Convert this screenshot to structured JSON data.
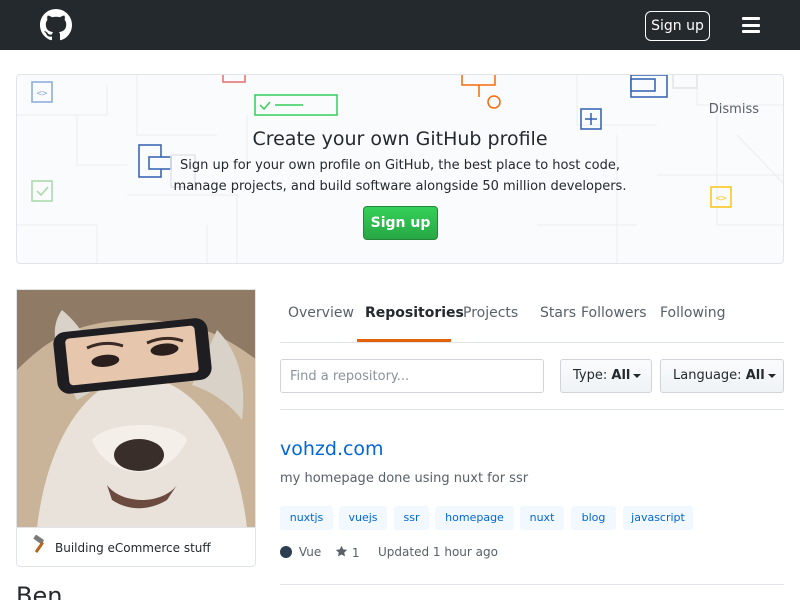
{
  "header": {
    "logo_icon": "github-octocat-icon",
    "signup_label": "Sign up",
    "menu_icon": "hamburger-menu-icon",
    "background": "#24292e"
  },
  "banner": {
    "title": "Create your own GitHub profile",
    "text": "Sign up for your own profile on GitHub, the best place to host code, manage projects, and build software alongside 50 million developers.",
    "button_label": "Sign up",
    "dismiss_label": "Dismiss",
    "button_color": "#28a745"
  },
  "profile": {
    "avatar_icon": "avatar-image",
    "status_icon": "hammer-icon",
    "status_text": "Building eCommerce stuff",
    "name": "Ben"
  },
  "tabs": [
    {
      "label": "Overview",
      "active": false
    },
    {
      "label": "Repositories",
      "active": true
    },
    {
      "label": "Projects",
      "active": false
    },
    {
      "label": "Stars",
      "active": false
    },
    {
      "label": "Followers",
      "active": false
    },
    {
      "label": "Following",
      "active": false
    }
  ],
  "filters": {
    "search_placeholder": "Find a repository...",
    "type_label": "Type:",
    "type_value": "All",
    "language_label": "Language:",
    "language_value": "All"
  },
  "repos": [
    {
      "name": "vohzd.com",
      "description": "my homepage done using nuxt for ssr",
      "topics": [
        "nuxtjs",
        "vuejs",
        "ssr",
        "homepage",
        "nuxt",
        "blog",
        "javascript"
      ],
      "language": "Vue",
      "language_color": "#2c3e50",
      "star_icon": "star-icon",
      "stars": "1",
      "updated": "Updated 1 hour ago"
    }
  ],
  "colors": {
    "link": "#0366d6",
    "active_tab_underline": "#e36209",
    "topic_bg": "#f1f8ff"
  }
}
